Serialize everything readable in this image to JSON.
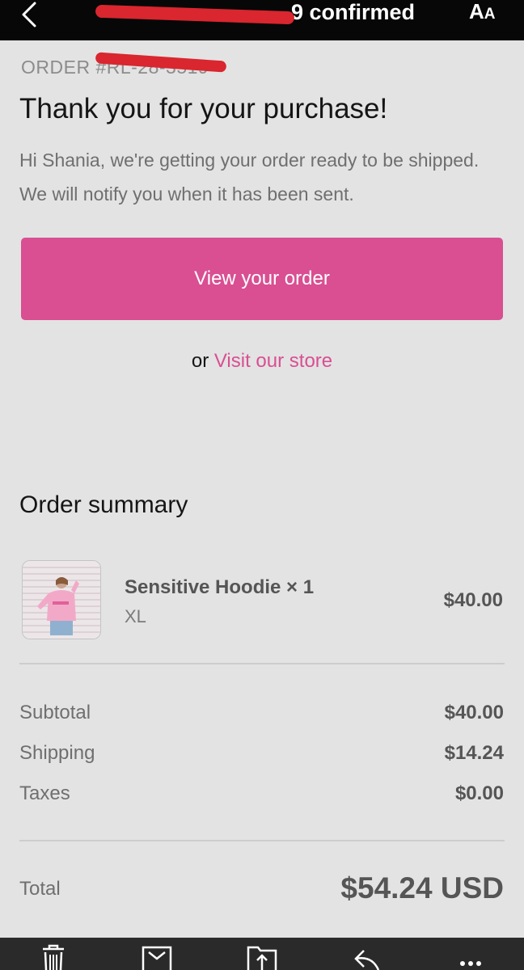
{
  "header": {
    "title_visible": "9 confirmed",
    "text_size_large": "A",
    "text_size_small": "A"
  },
  "email": {
    "order_number": "ORDER #RL-28-3519",
    "heading": "Thank you for your purchase!",
    "greeting": "Hi Shania, we're getting your order ready to be shipped. We will notify you when it has been sent.",
    "view_order_label": "View your order",
    "or_text": "or",
    "visit_store_label": "Visit our store",
    "accent_color": "#d94f92"
  },
  "summary": {
    "title": "Order summary",
    "item": {
      "name": "Sensitive Hoodie × 1",
      "variant": "XL",
      "price": "$40.00"
    },
    "lines": [
      {
        "label": "Subtotal",
        "value": "$40.00"
      },
      {
        "label": "Shipping",
        "value": "$14.24"
      },
      {
        "label": "Taxes",
        "value": "$0.00"
      }
    ],
    "total": {
      "label": "Total",
      "value": "$54.24 USD"
    }
  },
  "toolbar": {
    "icons": [
      "trash-icon",
      "archive-icon",
      "move-to-folder-icon",
      "reply-icon",
      "more-icon"
    ]
  }
}
